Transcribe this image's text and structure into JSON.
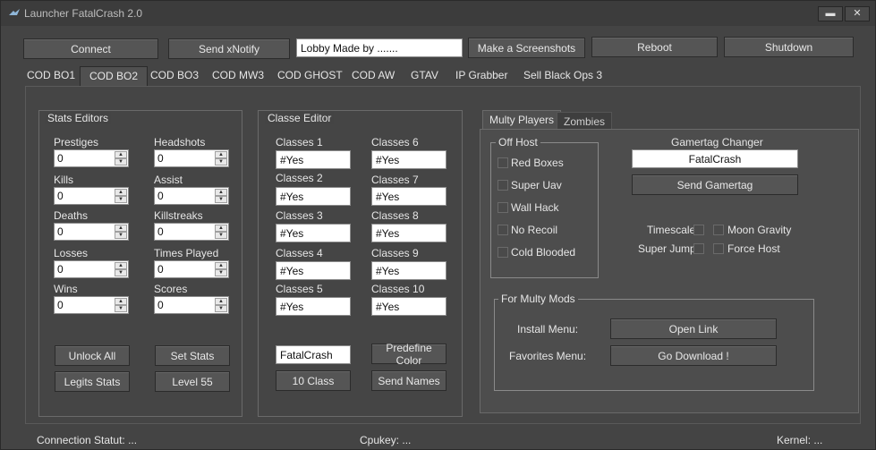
{
  "window": {
    "title": "Launcher FatalCrash 2.0",
    "minimize_label": "▬",
    "maximize_label": "□",
    "close_label": "✕"
  },
  "toolbar": {
    "connect": "Connect",
    "send_xnotify": "Send xNotify",
    "lobby_value": "Lobby Made by .......",
    "make_screenshots": "Make a Screenshots",
    "reboot": "Reboot",
    "shutdown": "Shutdown"
  },
  "tabs": [
    "COD BO1",
    "COD BO2",
    "COD BO3",
    "COD MW3",
    "COD GHOST",
    "COD AW",
    "GTAV",
    "IP Grabber",
    "Sell Black Ops 3"
  ],
  "stats": {
    "title": "Stats Editors",
    "fields": [
      {
        "label": "Prestiges",
        "value": "0"
      },
      {
        "label": "Headshots",
        "value": "0"
      },
      {
        "label": "Kills",
        "value": "0"
      },
      {
        "label": "Assist",
        "value": "0"
      },
      {
        "label": "Deaths",
        "value": "0"
      },
      {
        "label": "Killstreaks",
        "value": "0"
      },
      {
        "label": "Losses",
        "value": "0"
      },
      {
        "label": "Times Played",
        "value": "0"
      },
      {
        "label": "Wins",
        "value": "0"
      },
      {
        "label": "Scores",
        "value": "0"
      }
    ],
    "unlock_all": "Unlock All",
    "set_stats": "Set Stats",
    "legits_stats": "Legits Stats",
    "level_55": "Level 55"
  },
  "classes": {
    "title": "Classe Editor",
    "items": [
      {
        "label": "Classes 1",
        "value": "#Yes"
      },
      {
        "label": "Classes 6",
        "value": "#Yes"
      },
      {
        "label": "Classes 2",
        "value": "#Yes"
      },
      {
        "label": "Classes 7",
        "value": "#Yes"
      },
      {
        "label": "Classes 3",
        "value": "#Yes"
      },
      {
        "label": "Classes 8",
        "value": "#Yes"
      },
      {
        "label": "Classes 4",
        "value": "#Yes"
      },
      {
        "label": "Classes 9",
        "value": "#Yes"
      },
      {
        "label": "Classes 5",
        "value": "#Yes"
      },
      {
        "label": "Classes 10",
        "value": "#Yes"
      }
    ],
    "name_value": "FatalCrash",
    "predefine_color": "Predefine Color",
    "ten_class": "10 Class",
    "send_names": "Send Names"
  },
  "multi": {
    "tab_multy": "Multy Players",
    "tab_zombies": "Zombies",
    "off_host_title": "Off Host",
    "off_host": [
      "Red Boxes",
      "Super Uav",
      "Wall Hack",
      "No Recoil",
      "Cold Blooded"
    ],
    "gamertag_title": "Gamertag Changer",
    "gamertag_value": "FatalCrash",
    "send_gamertag": "Send  Gamertag",
    "timescale": "Timescale",
    "moon_gravity": "Moon Gravity",
    "super_jump": "Super Jump",
    "force_host": "Force Host",
    "mods_title": "For Multy Mods",
    "install_menu": "Install Menu:",
    "open_link": "Open Link",
    "favorites_menu": "Favorites Menu:",
    "go_download": "Go Download !"
  },
  "status": {
    "connection": "Connection Statut: ...",
    "cpukey": "Cpukey: ...",
    "kernel": "Kernel: ..."
  }
}
